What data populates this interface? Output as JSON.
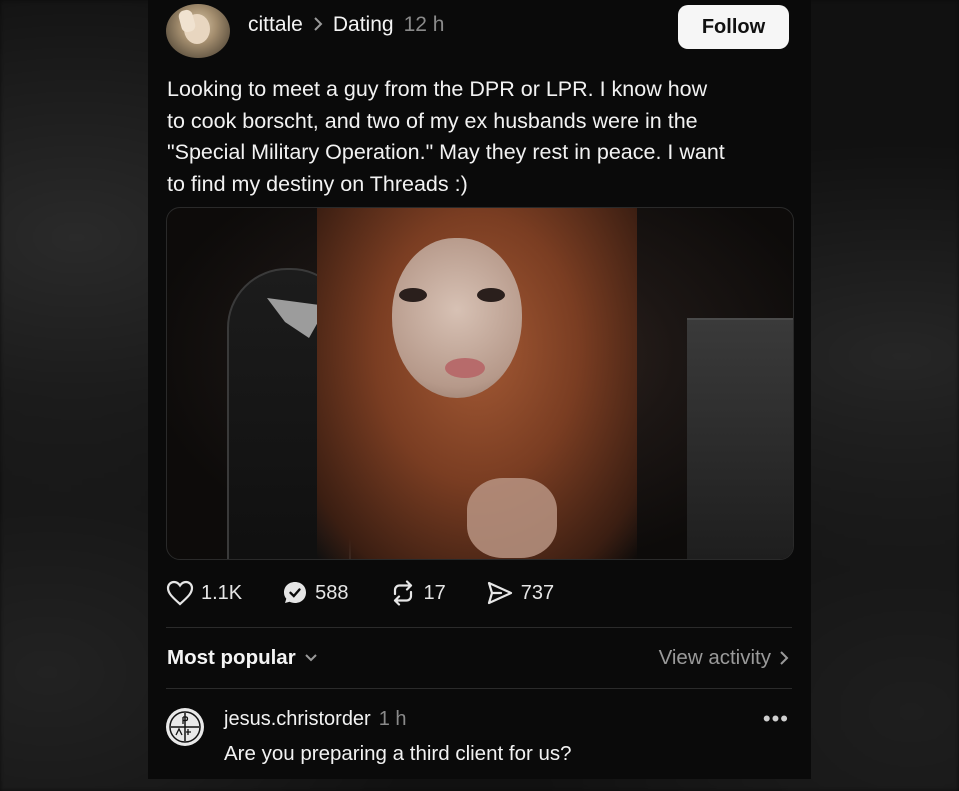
{
  "post": {
    "username": "cittale",
    "separator_icon": "chevron-right-icon",
    "topic": "Dating",
    "time": "12 h",
    "follow_label": "Follow",
    "text": "Looking to meet a guy from the DPR or LPR. I know how to cook borscht, and two of my ex husbands were in the \"Special Military Operation.\" May they rest in peace. I want to find my destiny on Threads :)",
    "stats": {
      "likes": "1.1K",
      "comments": "588",
      "reposts": "17",
      "shares": "737"
    }
  },
  "replies_header": {
    "sort_label": "Most popular",
    "view_activity_label": "View activity"
  },
  "reply": {
    "username": "jesus.christorder",
    "time": "1 h",
    "text": "Are you preparing a third client for us?",
    "more_label": "•••"
  },
  "colors": {
    "background": "#0a0a0a",
    "text": "#f2f2f2",
    "muted": "#8a8a8a",
    "follow_bg": "#f6f6f6"
  }
}
